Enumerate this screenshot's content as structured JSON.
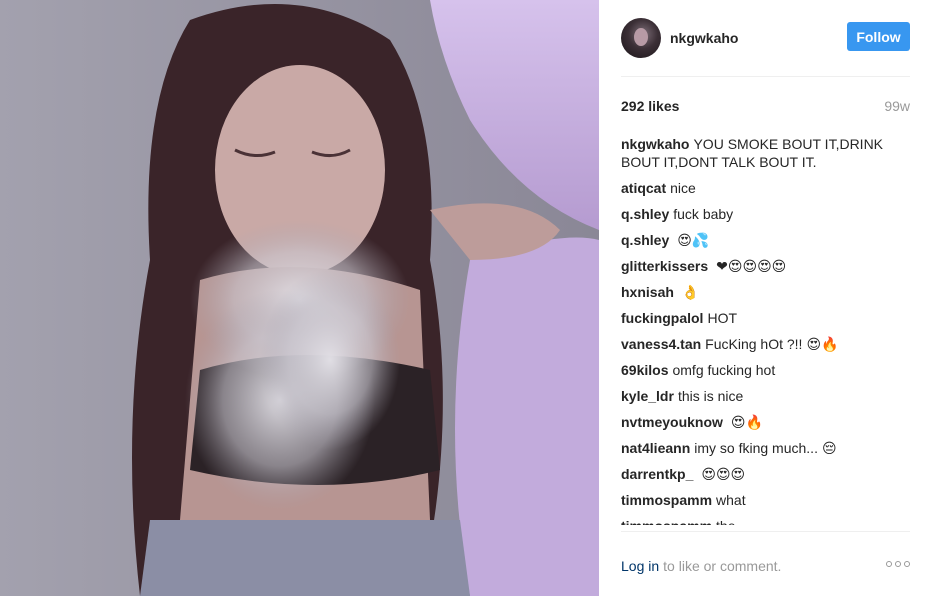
{
  "post": {
    "username": "nkgwkaho",
    "follow_label": "Follow",
    "likes": "292 likes",
    "age": "99w"
  },
  "comments": [
    {
      "user": "nkgwkaho",
      "text": "YOU SMOKE BOUT IT,DRINK BOUT IT,DONT TALK BOUT IT.",
      "emoji": ""
    },
    {
      "user": "atiqcat",
      "text": "nice",
      "emoji": ""
    },
    {
      "user": "q.shley",
      "text": "fuck baby",
      "emoji": ""
    },
    {
      "user": "q.shley",
      "text": "",
      "emoji": "😍💦"
    },
    {
      "user": "glitterkissers",
      "text": "",
      "emoji": "❤😍😍😍😍"
    },
    {
      "user": "hxnisah",
      "text": "",
      "emoji": "👌"
    },
    {
      "user": "fuckingpalol",
      "text": "HOT",
      "emoji": ""
    },
    {
      "user": "vaness4.tan",
      "text": "FucKing hOt ?!!",
      "emoji": "😍🔥"
    },
    {
      "user": "69kilos",
      "text": "omfg fucking hot",
      "emoji": ""
    },
    {
      "user": "kyle_ldr",
      "text": "this is nice",
      "emoji": ""
    },
    {
      "user": "nvtmeyouknow",
      "text": "",
      "emoji": "😍🔥"
    },
    {
      "user": "nat4lieann",
      "text": "imy so fking much...",
      "emoji": "😔"
    },
    {
      "user": "darrentkp_",
      "text": "",
      "emoji": "😍😍😍"
    },
    {
      "user": "timmospamm",
      "text": "what",
      "emoji": ""
    },
    {
      "user": "timmospamm",
      "text": "the",
      "emoji": ""
    }
  ],
  "footer": {
    "login_label": "Log in",
    "rest_text": "to like or comment."
  },
  "colors": {
    "follow_button": "#3897f0",
    "link": "#003569",
    "muted": "#999999"
  }
}
